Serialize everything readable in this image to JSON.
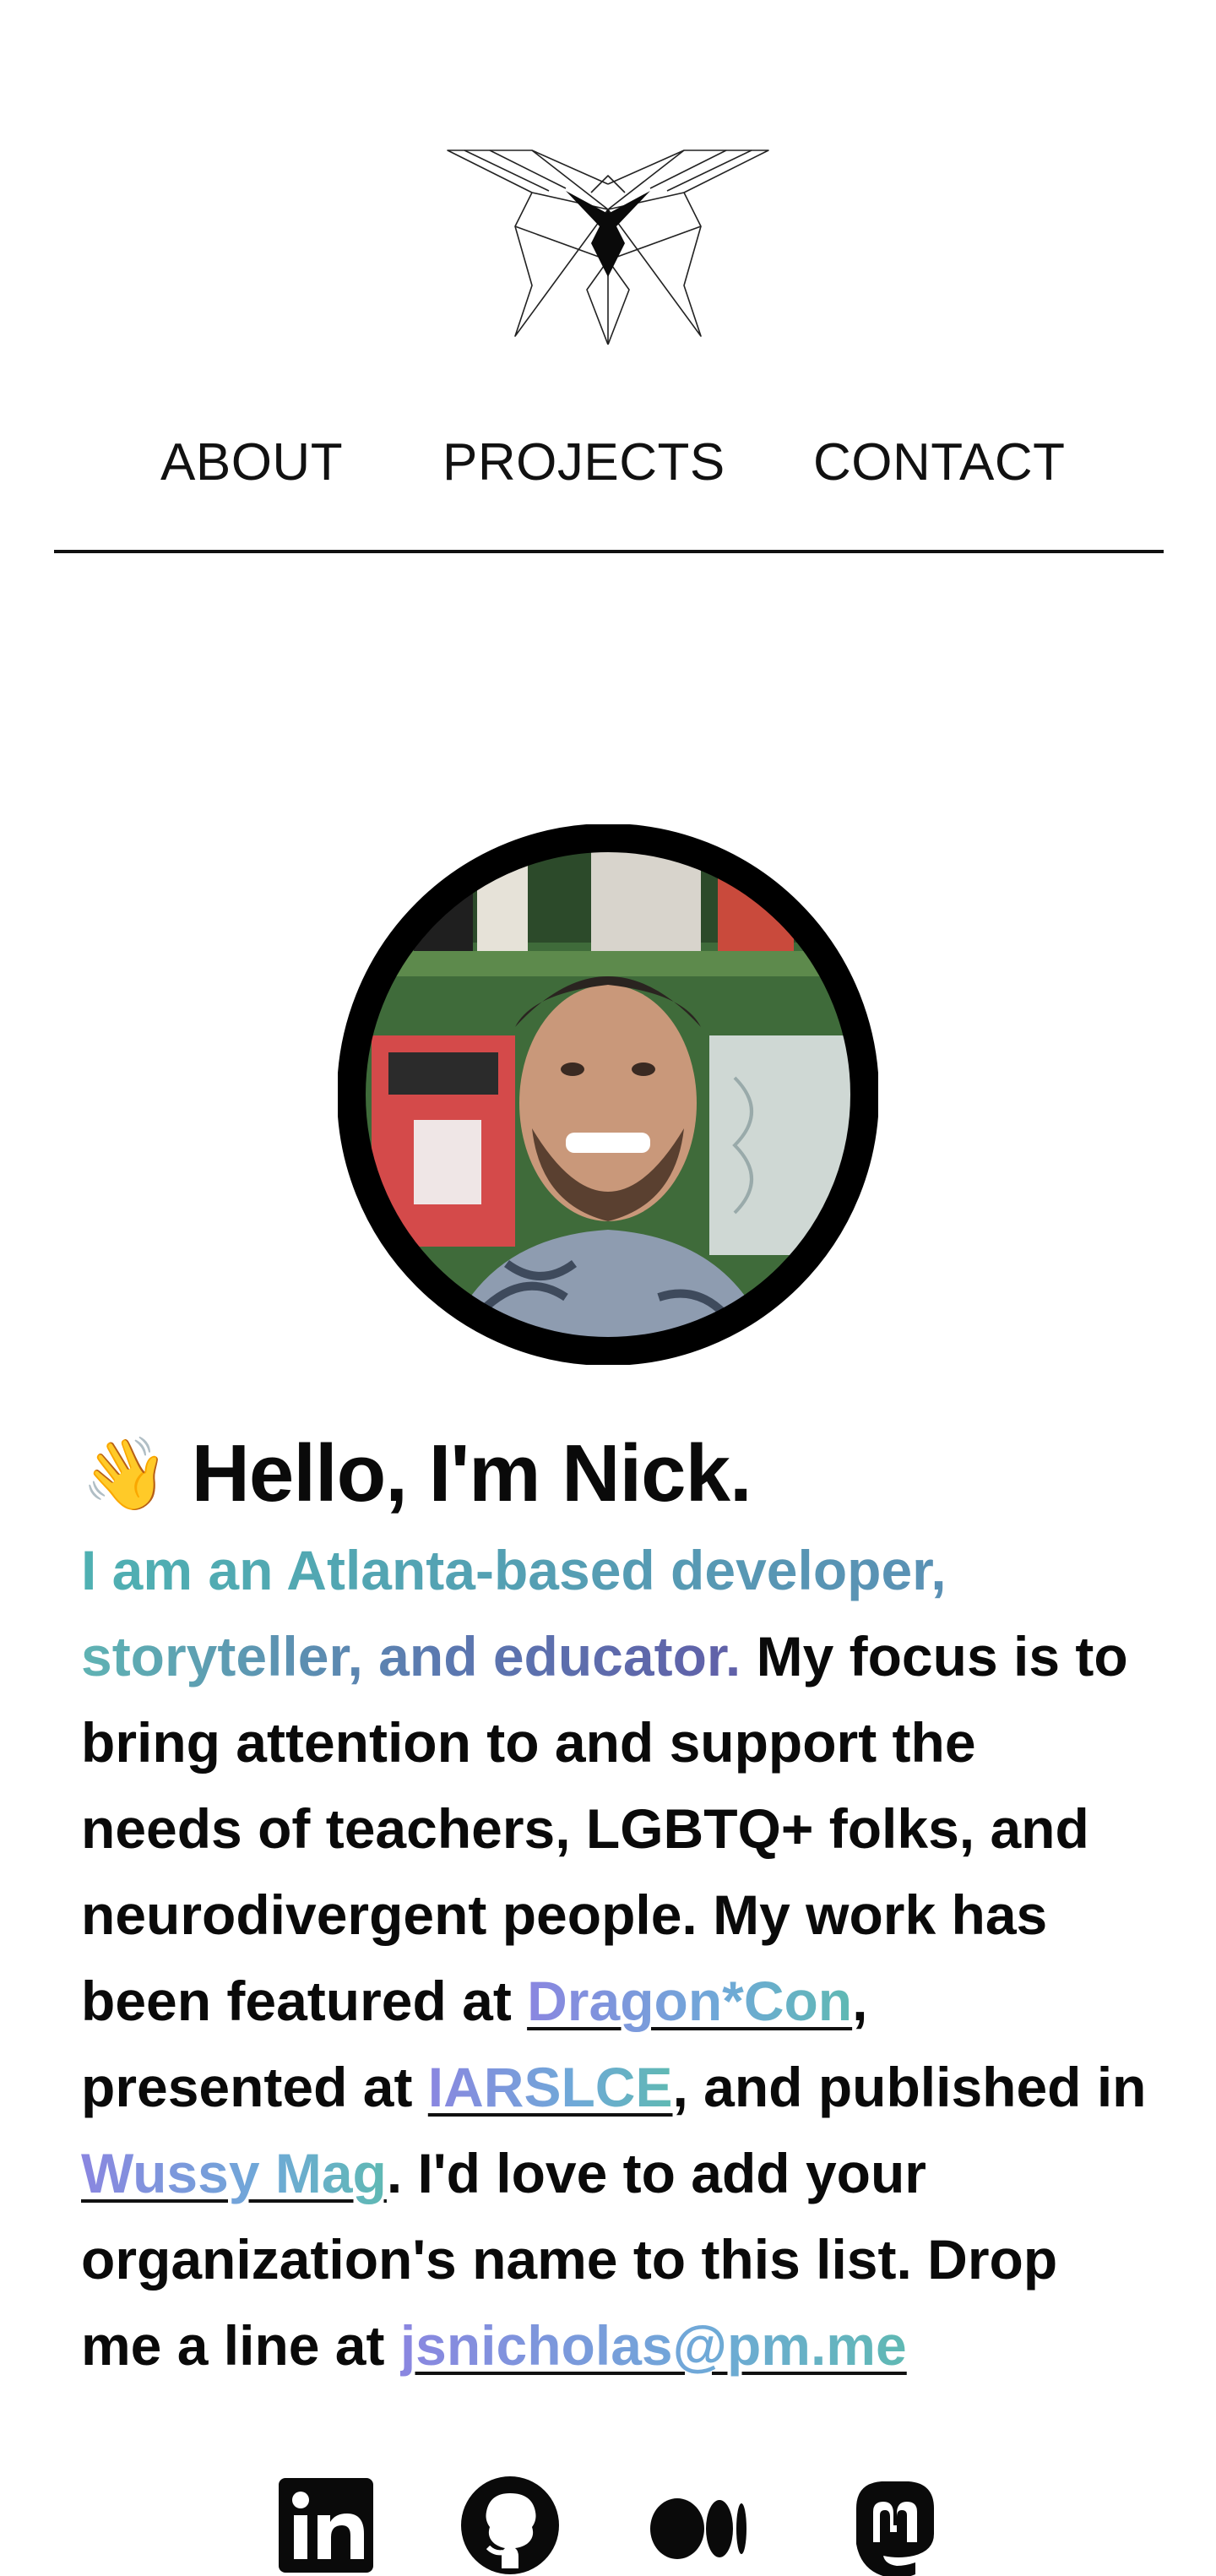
{
  "nav": {
    "items": [
      {
        "label": "ABOUT"
      },
      {
        "label": "PROJECTS"
      },
      {
        "label": "CONTACT"
      }
    ]
  },
  "logo": {
    "icon": "geometric-moth-icon"
  },
  "profile": {
    "avatar_icon": "profile-photo",
    "wave_emoji": "👋",
    "greeting": "Hello, I'm Nick."
  },
  "bio": {
    "tagline_1": "I am an Atlanta-based developer,",
    "tagline_2": "storyteller, and educator.",
    "t1": " My focus is to",
    "t2": "bring attention to and support the",
    "t3": "needs of teachers, LGBTQ+ folks, and",
    "t4": "neurodivergent people. My work has",
    "t5": "been featured at ",
    "link_dragoncon": "Dragon*Con",
    "t6": ",",
    "t7": "presented at ",
    "link_iarslce": "IARSLCE",
    "t8": ", and published in",
    "link_wussy": "Wussy Mag",
    "t9": ". I'd love to add your",
    "t10": "organization's name to this list. Drop",
    "t11": "me a line at ",
    "link_email": "jsnicholas@pm.me"
  },
  "social": [
    {
      "icon": "linkedin-icon"
    },
    {
      "icon": "github-icon"
    },
    {
      "icon": "medium-icon"
    },
    {
      "icon": "mastodon-icon"
    }
  ],
  "colors": {
    "text": "#0a0a0a",
    "gradient_start": "#4fb0b2",
    "gradient_mid": "#5b78b0",
    "gradient_end": "#6060a8",
    "link_start": "#8a86e0",
    "link_end": "#5fb9b3"
  }
}
